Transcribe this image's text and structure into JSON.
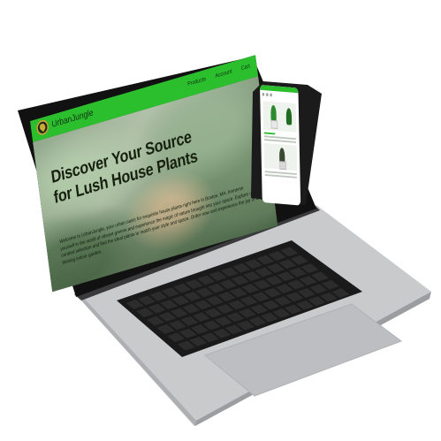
{
  "website": {
    "brand": "UrbanJungle",
    "nav": [
      "Products",
      "Account",
      "Cart"
    ],
    "headline_lines": [
      "Discover Your Source",
      "for Lush House Plants"
    ],
    "intro": "Welcome to UrbanJungle, your urban oasis for exquisite house plants right here in Boston, MA. Immerse yourself in the world of vibrant greens and experience the magic of nature brought into your space. Explore our curated selection and find the ideal plants to match your style and space. Order now and experience the joy of a thriving indoor garden."
  },
  "colors": {
    "brand_green": "#2bbf2e",
    "laptop_body": "#c9cacc",
    "bezel": "#111111",
    "keyboard": "#1a1a1a",
    "keys": "#2c2c2c"
  },
  "icons": [
    "leaf-logo-icon"
  ]
}
